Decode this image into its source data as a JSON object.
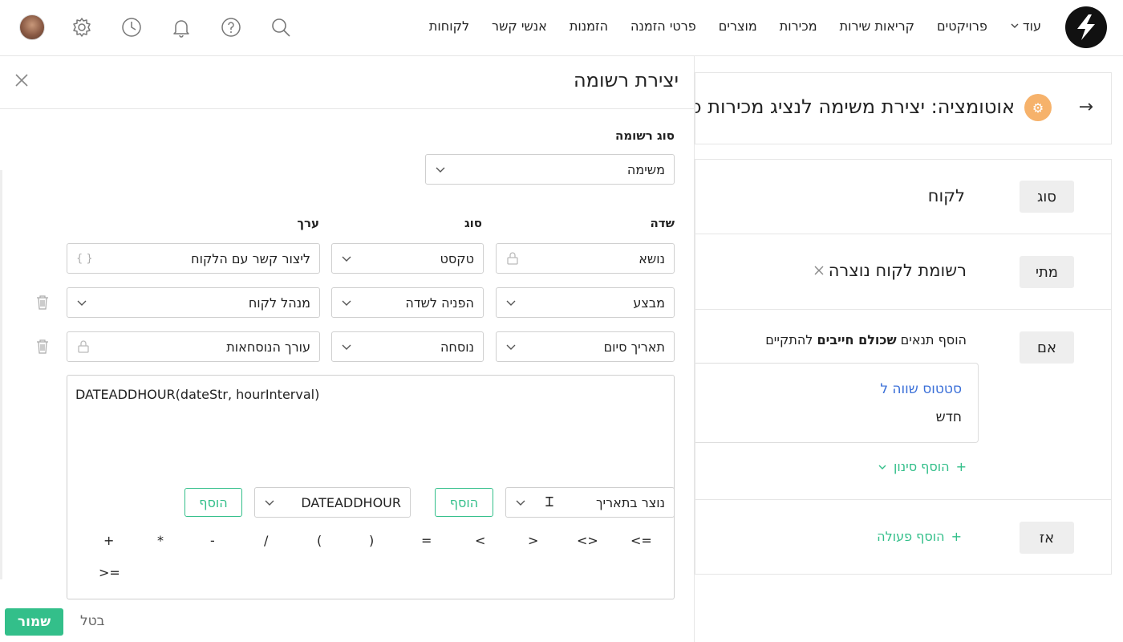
{
  "nav": {
    "items": [
      "לקוחות",
      "אנשי קשר",
      "הזמנות",
      "פרטי הזמנה",
      "מוצרים",
      "מכירות",
      "קריאות שירות",
      "פרויקטים"
    ],
    "more": "עוד"
  },
  "background": {
    "automation_title": "אוטומציה: יצירת משימה לנציג מכירות כ",
    "type_label": "סוג",
    "type_value": "לקוח",
    "when_label": "מתי",
    "when_value": "רשומת לקוח נוצרה",
    "if_label": "אם",
    "if_text_pre": "הוסף תנאים",
    "if_text_bold": "שכולם חייבים",
    "if_text_post": "להתקיים",
    "condition_field": "סטטוס שווה ל",
    "condition_value": "חדש",
    "add_filter": "הוסף סינון",
    "then_label": "אז",
    "add_action": "הוסף פעולה"
  },
  "drawer": {
    "title": "יצירת רשומה",
    "record_type_label": "סוג רשומה",
    "record_type_value": "משימה",
    "col_field": "שדה",
    "col_type": "סוג",
    "col_value": "ערך",
    "rows": [
      {
        "field": "נושא",
        "type": "טקסט",
        "value": "ליצור קשר עם הלקוח"
      },
      {
        "field": "מבצע",
        "type": "הפניה לשדה",
        "value": "מנהל לקוח"
      },
      {
        "field": "תאריך סיום",
        "type": "נוסחה",
        "value": "עורך הנוסחאות"
      }
    ],
    "formula": "DATEADDHOUR(dateStr, hourInterval)",
    "field_picker": "נוצר בתאריך",
    "add_label": "הוסף",
    "function_picker": "DATEADDHOUR",
    "operators": [
      "<=",
      "<>",
      ">",
      "<",
      "=",
      ")",
      "(",
      "/",
      "-",
      "*",
      "+",
      ">="
    ],
    "save": "שמור",
    "cancel": "בטל"
  },
  "colors": {
    "accent_green": "#33bf8a",
    "badge_orange": "#f6b26b",
    "link_blue": "#3a6fd8"
  }
}
